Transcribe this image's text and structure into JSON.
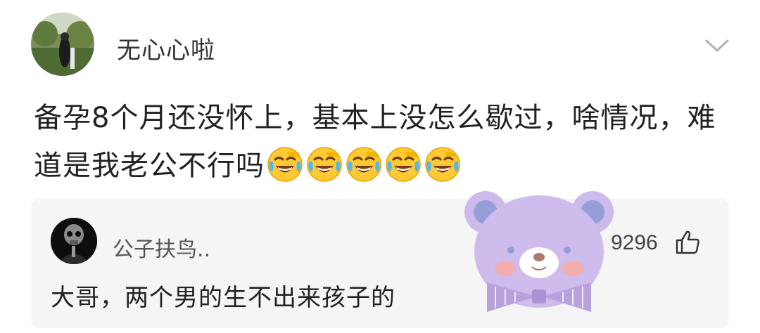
{
  "post": {
    "username": "无心心啦",
    "text": "备孕8个月还没怀上，基本上没怎么歇过，啥情况，难道是我老公不行吗",
    "emojis": [
      "laugh-cry-emoji",
      "laugh-cry-emoji",
      "laugh-cry-emoji",
      "laugh-cry-emoji",
      "laugh-cry-emoji"
    ]
  },
  "comment": {
    "username": "公子扶鸟..",
    "text": "大哥，两个男的生不出来孩子的",
    "likes": "9296"
  },
  "colors": {
    "card_bg": "#f5f5f5",
    "sticker_purple": "#c9b6ea",
    "sticker_ears": "#8e97d6"
  }
}
